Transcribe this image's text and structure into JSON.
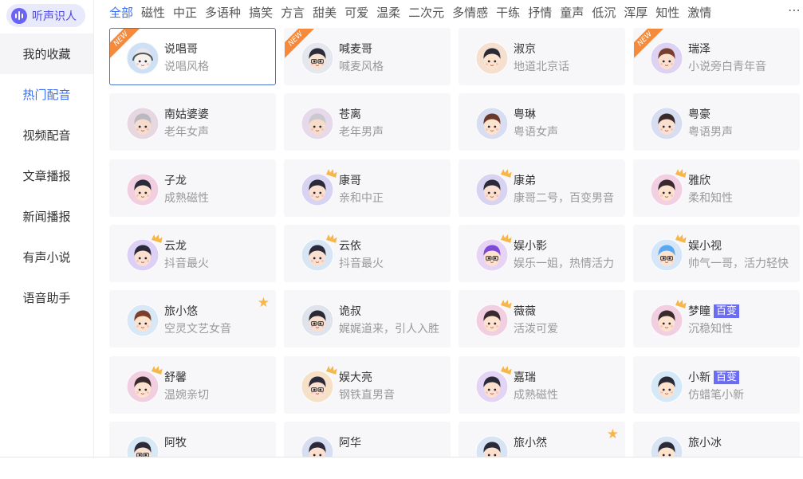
{
  "brand": {
    "label": "听声识人"
  },
  "sidebar": {
    "items": [
      {
        "label": "我的收藏"
      },
      {
        "label": "热门配音"
      },
      {
        "label": "视频配音"
      },
      {
        "label": "文章播报"
      },
      {
        "label": "新闻播报"
      },
      {
        "label": "有声小说"
      },
      {
        "label": "语音助手"
      }
    ]
  },
  "tabs": [
    "全部",
    "磁性",
    "中正",
    "多语种",
    "搞笑",
    "方言",
    "甜美",
    "可爱",
    "温柔",
    "二次元",
    "多情感",
    "干练",
    "抒情",
    "童声",
    "低沉",
    "浑厚",
    "知性",
    "激情"
  ],
  "more_label": "⋯",
  "badge_label": "百变",
  "new_label": "NEW",
  "star_glyph": "★",
  "colors": {
    "accent": "#3b6ff5",
    "new_ribbon": "#f58a3c",
    "badge": "#6b6bf6",
    "crown": "#f7b64a",
    "selected_border": "#4c73c7"
  },
  "cards": [
    {
      "name": "说唱哥",
      "desc": "说唱风格",
      "tag": "new",
      "avatar": "rapper-avatar",
      "bg": "#cfe0f4",
      "skin": "#f7f2ee",
      "hair": "#e9e7ee",
      "top": "headphones",
      "glasses": false
    },
    {
      "name": "喊麦哥",
      "desc": "喊麦风格",
      "tag": "new",
      "avatar": "shouting-mc-avatar",
      "bg": "#e5e7ee",
      "skin": "#fbe2cf",
      "hair": "#2b2d3a",
      "top": "none",
      "glasses": true
    },
    {
      "name": "淑京",
      "desc": "地道北京话",
      "tag": "none",
      "avatar": "beijing-girl-avatar",
      "bg": "#f5e0cf",
      "skin": "#fde3cd",
      "hair": "#2a2a36",
      "top": "none",
      "glasses": false
    },
    {
      "name": "瑞泽",
      "desc": "小说旁白青年音",
      "tag": "new",
      "avatar": "narrator-young-avatar",
      "bg": "#ddd2f2",
      "skin": "#fbe0cf",
      "hair": "#7a3e2c",
      "top": "none",
      "glasses": false
    },
    {
      "name": "南姑婆婆",
      "desc": "老年女声",
      "tag": "none",
      "avatar": "old-woman-avatar",
      "bg": "#e6d7e0",
      "skin": "#f6dccc",
      "hair": "#b9b9c0",
      "top": "none",
      "glasses": false
    },
    {
      "name": "苍离",
      "desc": "老年男声",
      "tag": "none",
      "avatar": "old-man-avatar",
      "bg": "#e5d9ea",
      "skin": "#f6dcc9",
      "hair": "#c9c9cf",
      "top": "none",
      "glasses": false
    },
    {
      "name": "粤琳",
      "desc": "粤语女声",
      "tag": "none",
      "avatar": "cantonese-girl-avatar",
      "bg": "#d8ddf2",
      "skin": "#fde3cd",
      "hair": "#6a3728",
      "top": "none",
      "glasses": false
    },
    {
      "name": "粤豪",
      "desc": "粤语男声",
      "tag": "none",
      "avatar": "cantonese-man-avatar",
      "bg": "#d7def1",
      "skin": "#fbe0cf",
      "hair": "#3a2b2a",
      "top": "none",
      "glasses": false
    },
    {
      "name": "子龙",
      "desc": "成熟磁性",
      "tag": "none",
      "avatar": "zilong-avatar",
      "bg": "#f1cfe0",
      "skin": "#fbe0cf",
      "hair": "#2a2a3a",
      "top": "none",
      "glasses": false
    },
    {
      "name": "康哥",
      "desc": "亲和中正",
      "tag": "crown",
      "avatar": "kangge-avatar",
      "bg": "#d9d3f2",
      "skin": "#fbe0cf",
      "hair": "#2a2a3a",
      "top": "none",
      "glasses": false
    },
    {
      "name": "康弟",
      "desc": "康哥二号，百变男音",
      "tag": "crown",
      "avatar": "kangdi-avatar",
      "bg": "#d9d3f2",
      "skin": "#fbe0cf",
      "hair": "#2a2a3a",
      "top": "none",
      "glasses": false
    },
    {
      "name": "雅欣",
      "desc": "柔和知性",
      "tag": "crown",
      "avatar": "yaxin-avatar",
      "bg": "#f2cfe2",
      "skin": "#fde3cd",
      "hair": "#3a2a2e",
      "top": "none",
      "glasses": false
    },
    {
      "name": "云龙",
      "desc": "抖音最火",
      "tag": "crown",
      "avatar": "yunlong-avatar",
      "bg": "#dcd0f6",
      "skin": "#fbe0cf",
      "hair": "#2a2a3a",
      "top": "none",
      "glasses": false
    },
    {
      "name": "云依",
      "desc": "抖音最火",
      "tag": "crown",
      "avatar": "yunyi-avatar",
      "bg": "#d7e6f2",
      "skin": "#fbe0cf",
      "hair": "#2a2a3a",
      "top": "none",
      "glasses": false
    },
    {
      "name": "娱小影",
      "desc": "娱乐一姐，热情活力",
      "tag": "crown",
      "avatar": "yuxiaoying-avatar",
      "bg": "#e7d3f4",
      "skin": "#fde3cd",
      "hair": "#7d4bd8",
      "top": "none",
      "glasses": true
    },
    {
      "name": "娱小视",
      "desc": "帅气一哥，活力轻快",
      "tag": "crown",
      "avatar": "yuxiaoshi-avatar",
      "bg": "#d4e6f8",
      "skin": "#fde3cd",
      "hair": "#5aa8ef",
      "top": "none",
      "glasses": true
    },
    {
      "name": "旅小悠",
      "desc": "空灵文艺女音",
      "tag": "star",
      "avatar": "lvxiaoyou-avatar",
      "bg": "#d8e8f7",
      "skin": "#fde3cd",
      "hair": "#7a3e2c",
      "top": "none",
      "glasses": false
    },
    {
      "name": "诡叔",
      "desc": "娓娓道来，引人入胜",
      "tag": "none",
      "avatar": "guishu-avatar",
      "bg": "#dfe3ec",
      "skin": "#fbe0cf",
      "hair": "#2a2a36",
      "top": "none",
      "glasses": true
    },
    {
      "name": "薇薇",
      "desc": "活泼可爱",
      "tag": "crown",
      "avatar": "weiwei-avatar",
      "bg": "#f2cfe0",
      "skin": "#fde3cd",
      "hair": "#3a2a2e",
      "top": "none",
      "glasses": false
    },
    {
      "name": "梦瞳",
      "desc": "沉稳知性",
      "tag": "crown",
      "badge": true,
      "avatar": "mengtong-avatar",
      "bg": "#f2cfe0",
      "skin": "#fde3cd",
      "hair": "#3a2a2e",
      "top": "none",
      "glasses": false
    },
    {
      "name": "舒馨",
      "desc": "温婉亲切",
      "tag": "crown",
      "avatar": "shuxin-avatar",
      "bg": "#f2cfe0",
      "skin": "#fde3cd",
      "hair": "#3a2a2e",
      "top": "none",
      "glasses": false
    },
    {
      "name": "娱大亮",
      "desc": "钢铁直男音",
      "tag": "crown",
      "avatar": "yudaliang-avatar",
      "bg": "#f6e0c8",
      "skin": "#fbe0cf",
      "hair": "#2a2a3a",
      "top": "none",
      "glasses": true
    },
    {
      "name": "嘉瑞",
      "desc": "成熟磁性",
      "tag": "crown",
      "avatar": "jiarui-avatar",
      "bg": "#e3d3f4",
      "skin": "#fbe0cf",
      "hair": "#2a2a3a",
      "top": "none",
      "glasses": false
    },
    {
      "name": "小新",
      "desc": "仿蜡笔小新",
      "tag": "none",
      "badge": true,
      "avatar": "xiaoxin-avatar",
      "bg": "#d5e8f7",
      "skin": "#fde3cd",
      "hair": "#2a2a36",
      "top": "none",
      "glasses": false
    },
    {
      "name": "阿牧",
      "desc": "",
      "tag": "none",
      "avatar": "amu-avatar",
      "bg": "#d8e8f4",
      "skin": "#fbe0cf",
      "hair": "#2a2a3a",
      "top": "none",
      "glasses": true
    },
    {
      "name": "阿华",
      "desc": "",
      "tag": "none",
      "avatar": "ahua-avatar",
      "bg": "#d8def2",
      "skin": "#fbe0cf",
      "hair": "#2a2a3a",
      "top": "none",
      "glasses": false
    },
    {
      "name": "旅小然",
      "desc": "",
      "tag": "star",
      "avatar": "lvxiaoran-avatar",
      "bg": "#d8e4f4",
      "skin": "#fbe0cf",
      "hair": "#2a2a3a",
      "top": "none",
      "glasses": false
    },
    {
      "name": "旅小冰",
      "desc": "",
      "tag": "none",
      "avatar": "lvxiaobing-avatar",
      "bg": "#d8e4f4",
      "skin": "#fde3cd",
      "hair": "#2a2a3a",
      "top": "none",
      "glasses": false
    }
  ]
}
